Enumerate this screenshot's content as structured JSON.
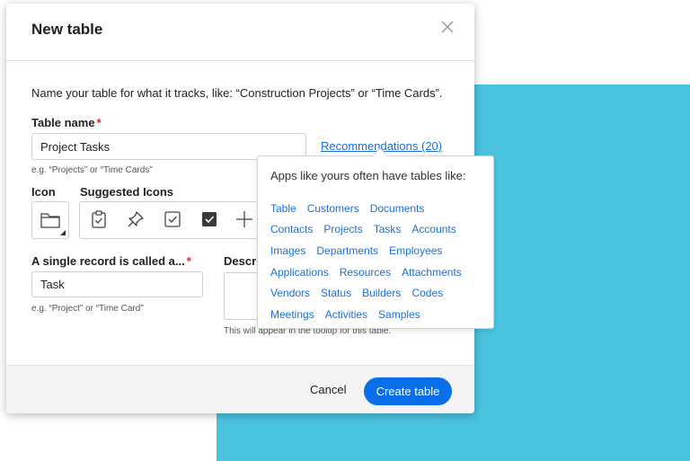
{
  "dialog": {
    "title": "New table",
    "intro": "Name your table for what it tracks, like: “Construction Projects” or “Time Cards”.",
    "table_name": {
      "label": "Table name",
      "required": "*",
      "value": "Project Tasks",
      "hint": "e.g. “Projects” or “Time Cards”"
    },
    "recommendations_link": "Recommendations (20)",
    "icon_label": "Icon",
    "suggested_icons_label": "Suggested Icons",
    "suggested_icons": [
      "clipboard-check-icon",
      "pin-icon",
      "checkbox-icon",
      "checkbox-filled-icon",
      "plus-icon"
    ],
    "single_record": {
      "label": "A single record is called a...",
      "required": "*",
      "value": "Task",
      "hint": "e.g. “Project” or “Time Card”"
    },
    "description": {
      "label": "Descri",
      "hint": "This will appear in the tooltip for this table."
    },
    "footer": {
      "cancel": "Cancel",
      "create": "Create table"
    }
  },
  "popover": {
    "title": "Apps like yours often have tables like:",
    "rows": [
      [
        "Table",
        "Customers",
        "Documents"
      ],
      [
        "Contacts",
        "Projects",
        "Tasks",
        "Accounts"
      ],
      [
        "Images",
        "Departments",
        "Employees"
      ],
      [
        "Applications",
        "Resources",
        "Attachments"
      ],
      [
        "Vendors",
        "Status",
        "Builders",
        "Codes"
      ],
      [
        "Meetings",
        "Activities",
        "Samples"
      ]
    ]
  },
  "colors": {
    "accent": "#0a6fe8",
    "link": "#1a6fd8",
    "required": "#e0282e",
    "background_shape": "#4ac3df"
  }
}
